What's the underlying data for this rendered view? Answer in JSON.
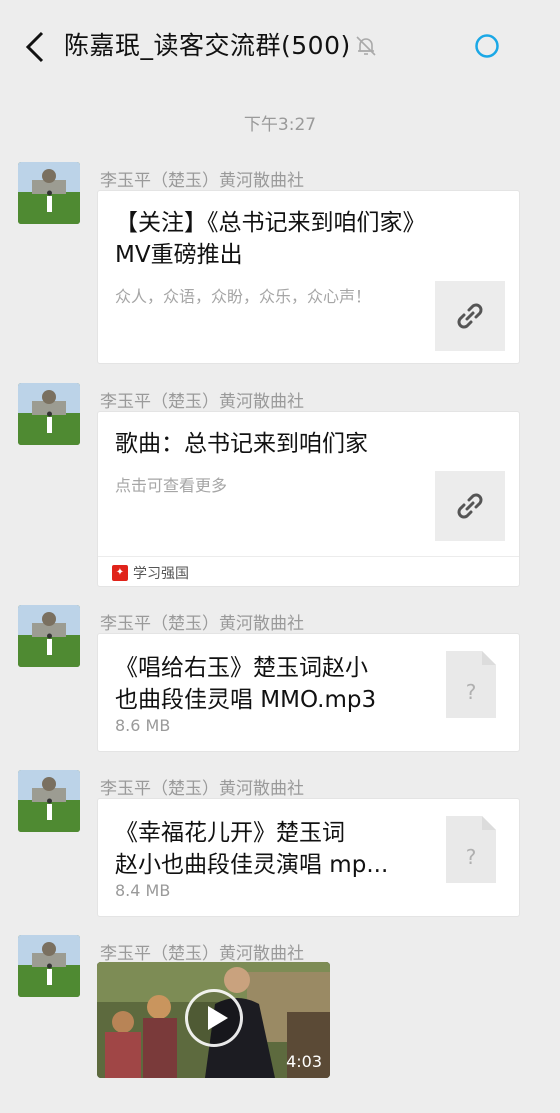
{
  "header": {
    "title": "陈嘉珉_读客交流群(500)",
    "back_icon": "chevron-left-icon",
    "mute_icon": "bell-muted-icon",
    "status_icon": "loading-ring-icon",
    "accent": "#1ba8e6"
  },
  "timestamp": "下午3:27",
  "messages": [
    {
      "sender": "李玉平（楚玉）黄河散曲社",
      "type": "link",
      "title": "【关注】《总书记来到咱们家》\nMV重磅推出",
      "desc": "众人，众语，众盼，众乐，众心声！",
      "thumb_icon": "link-icon"
    },
    {
      "sender": "李玉平（楚玉）黄河散曲社",
      "type": "link",
      "title": "歌曲：总书记来到咱们家",
      "desc": "点击可查看更多",
      "thumb_icon": "link-icon",
      "source": "学习强国",
      "source_color": "#e0231a"
    },
    {
      "sender": "李玉平（楚玉）黄河散曲社",
      "type": "file",
      "title": "《唱给右玉》楚玉词赵小\n也曲段佳灵唱 MMO.mp3",
      "size": "8.6 MB",
      "file_icon": "unknown-file-icon"
    },
    {
      "sender": "李玉平（楚玉）黄河散曲社",
      "type": "file",
      "title": "《幸福花儿开》楚玉词\n赵小也曲段佳灵演唱 mp...",
      "size": "8.4 MB",
      "file_icon": "unknown-file-icon"
    },
    {
      "sender": "李玉平（楚玉）黄河散曲社",
      "type": "video",
      "duration": "4:03",
      "play_icon": "play-icon"
    }
  ]
}
